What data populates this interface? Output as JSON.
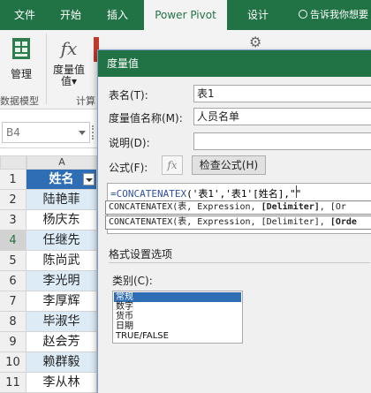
{
  "ribbon": {
    "tabs": [
      {
        "label": "文件"
      },
      {
        "label": "开始"
      },
      {
        "label": "插入"
      },
      {
        "label": "Power Pivot"
      },
      {
        "label": "设计"
      }
    ],
    "active_tab": "Power Pivot",
    "tell_me": "告诉我你想要",
    "buttons": {
      "manage": "管理",
      "measures": "度量值"
    },
    "groups": {
      "data_model": "数据模型",
      "calc": "计算"
    }
  },
  "formula_bar": {
    "name_box": "B4"
  },
  "sheet": {
    "column_header": "A",
    "header_cell": "姓名",
    "rows": [
      {
        "num": "1",
        "value": "姓名"
      },
      {
        "num": "2",
        "value": "陆艳菲"
      },
      {
        "num": "3",
        "value": "杨庆东"
      },
      {
        "num": "4",
        "value": "任继先"
      },
      {
        "num": "5",
        "value": "陈尚武"
      },
      {
        "num": "6",
        "value": "李光明"
      },
      {
        "num": "7",
        "value": "李厚辉"
      },
      {
        "num": "8",
        "value": "毕淑华"
      },
      {
        "num": "9",
        "value": "赵会芳"
      },
      {
        "num": "10",
        "value": "赖群毅"
      },
      {
        "num": "11",
        "value": "李从林"
      }
    ],
    "selected_row": "4"
  },
  "dialog": {
    "title": "度量值",
    "table_label": "表名(T):",
    "table_value": "表1",
    "measure_label": "度量值名称(M):",
    "measure_value": "人员名单",
    "desc_label": "说明(D):",
    "desc_value": "",
    "formula_label": "公式(F):",
    "fx_label": "fx",
    "check_button": "检查公式(H)",
    "formula_fn": "=CONCATENATEX",
    "formula_rest": "('表1','表1'[姓名],\"\"",
    "tooltip_1_pre": "CONCATENATEX(表, Expression, ",
    "tooltip_1_bold": "[Delimiter]",
    "tooltip_1_post": ", [Or",
    "tooltip_2_pre": "CONCATENATEX(表, Expression, [Delimiter], ",
    "tooltip_2_bold": "[Orde",
    "format_section": "格式设置选项",
    "category_label": "类别(C):",
    "categories": [
      "常规",
      "数字",
      "货币",
      "日期",
      "TRUE/FALSE"
    ],
    "selected_category": "常规"
  },
  "colors": {
    "ribbon_green": "#217346",
    "header_blue": "#2f6eb5",
    "row_fill": "#ddebf7"
  }
}
